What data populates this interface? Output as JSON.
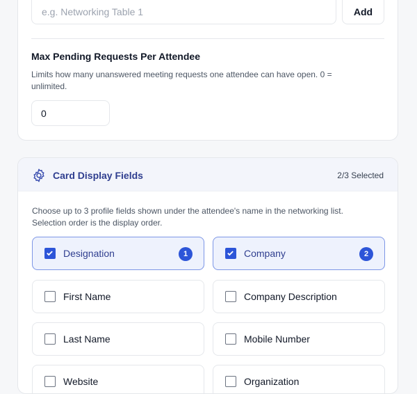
{
  "table_form": {
    "input_placeholder": "e.g. Networking Table 1",
    "input_value": "",
    "add_label": "Add"
  },
  "max_pending": {
    "title": "Max Pending Requests Per Attendee",
    "description": "Limits how many unanswered meeting requests one attendee can have open. 0 = unlimited.",
    "value": "0"
  },
  "card_fields": {
    "icon": "gear-icon",
    "title": "Card Display Fields",
    "selected_count": "2/3 Selected",
    "description": "Choose up to 3 profile fields shown under the attendee's name in the networking list. Selection order is the display order.",
    "options": [
      {
        "label": "Designation",
        "checked": true,
        "order": "1"
      },
      {
        "label": "Company",
        "checked": true,
        "order": "2"
      },
      {
        "label": "First Name",
        "checked": false,
        "order": ""
      },
      {
        "label": "Company Description",
        "checked": false,
        "order": ""
      },
      {
        "label": "Last Name",
        "checked": false,
        "order": ""
      },
      {
        "label": "Mobile Number",
        "checked": false,
        "order": ""
      },
      {
        "label": "Website",
        "checked": false,
        "order": ""
      },
      {
        "label": "Organization",
        "checked": false,
        "order": ""
      }
    ]
  },
  "colors": {
    "accent": "#2d55d8",
    "selected_bg": "#eef2fd",
    "header_bg": "#f3f5fb"
  }
}
